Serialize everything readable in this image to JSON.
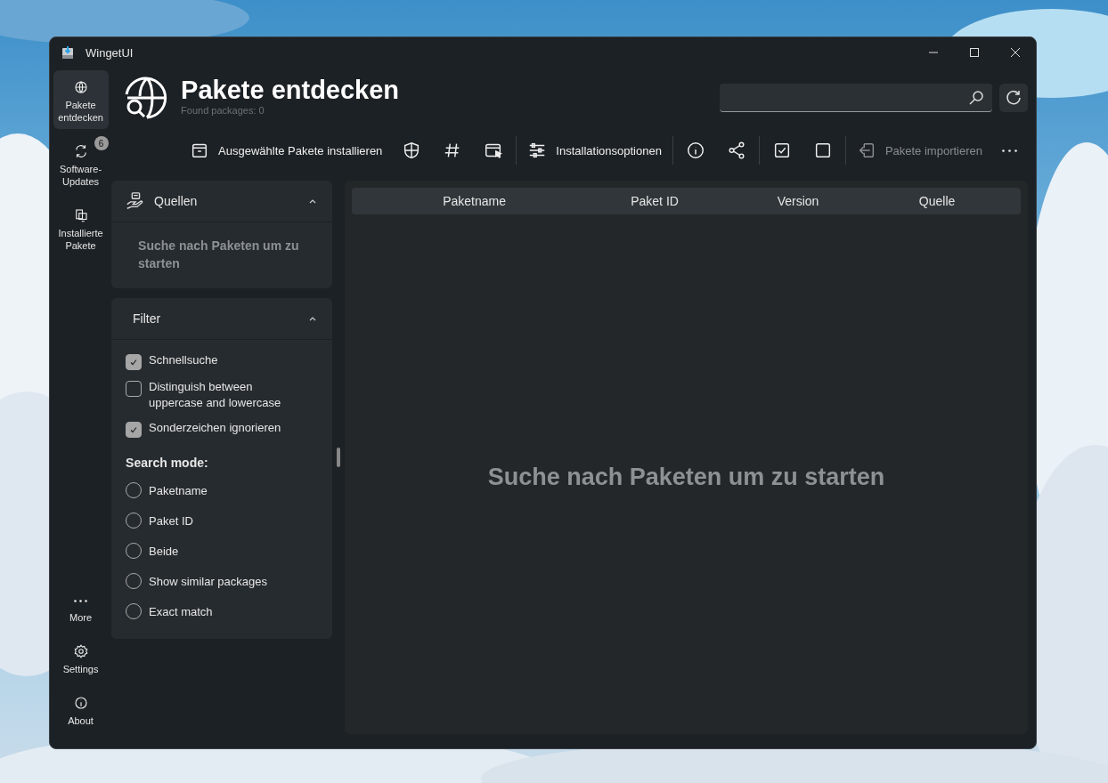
{
  "window": {
    "title": "WingetUI"
  },
  "sidebar": {
    "items": [
      {
        "label": "Pakete entdecken",
        "selected": true
      },
      {
        "label": "Software-Updates",
        "selected": false,
        "badge": "6"
      },
      {
        "label": "Installierte Pakete",
        "selected": false
      }
    ],
    "bottom_items": [
      {
        "label": "More",
        "selected": false
      },
      {
        "label": "Settings",
        "selected": false
      },
      {
        "label": "About",
        "selected": false
      }
    ]
  },
  "header": {
    "title": "Pakete entdecken",
    "subtitle": "Found packages: 0"
  },
  "toolbar": [
    [
      {
        "kind": "labeled",
        "label": "Ausgewählte Pakete installieren",
        "disabled": false
      },
      {
        "kind": "icon"
      },
      {
        "kind": "icon"
      },
      {
        "kind": "icon"
      }
    ],
    [
      {
        "kind": "labeled",
        "label": "Installationsoptionen",
        "disabled": false
      }
    ],
    [
      {
        "kind": "icon"
      },
      {
        "kind": "icon"
      }
    ],
    [
      {
        "kind": "icon"
      },
      {
        "kind": "icon"
      }
    ],
    [
      {
        "kind": "labeled",
        "label": "Pakete importieren",
        "disabled": true
      },
      {
        "kind": "icon"
      }
    ]
  ],
  "sources": {
    "title": "Quellen",
    "expanded": true,
    "message": "Suche nach Paketen um zu starten"
  },
  "filter": {
    "title": "Filter",
    "expanded": true,
    "options": [
      {
        "label": "Schnellsuche",
        "checked": true
      },
      {
        "label": "Distinguish between uppercase and lowercase",
        "checked": false
      },
      {
        "label": "Sonderzeichen ignorieren",
        "checked": true
      }
    ],
    "search_mode_label": "Search mode:",
    "modes": [
      {
        "label": "Paketname",
        "selected": false
      },
      {
        "label": "Paket ID",
        "selected": false
      },
      {
        "label": "Beide",
        "selected": false
      },
      {
        "label": "Show similar packages",
        "selected": false
      },
      {
        "label": "Exact match",
        "selected": false
      }
    ]
  },
  "table": {
    "columns": [
      "Paketname",
      "Paket ID",
      "Version",
      "Quelle"
    ],
    "empty_message": "Suche nach Paketen um zu starten"
  }
}
